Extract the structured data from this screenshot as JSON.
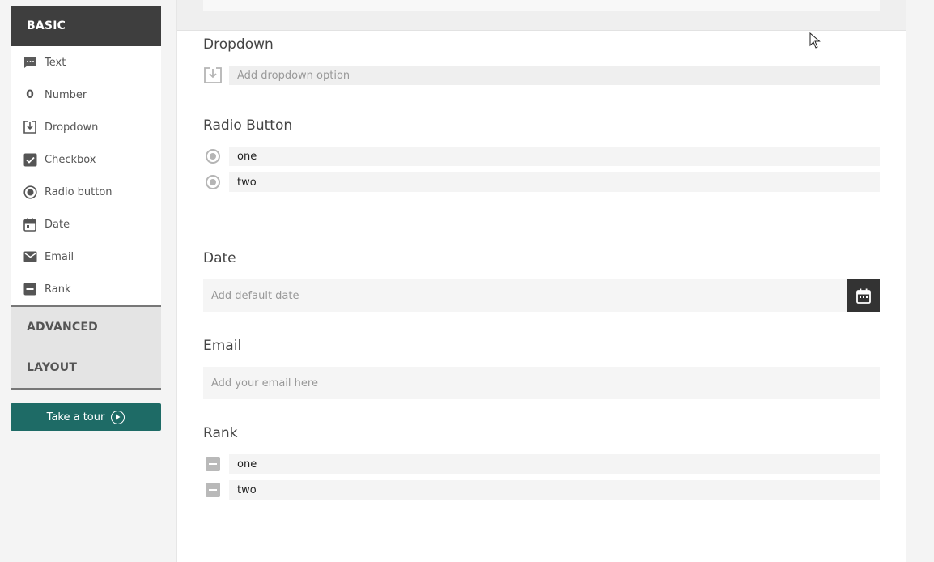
{
  "sidebar": {
    "basic_label": "BASIC",
    "items": [
      {
        "label": "Text",
        "icon": "text-icon"
      },
      {
        "label": "Number",
        "icon": "number-icon"
      },
      {
        "label": "Dropdown",
        "icon": "dropdown-icon"
      },
      {
        "label": "Checkbox",
        "icon": "checkbox-icon"
      },
      {
        "label": "Radio button",
        "icon": "radio-icon"
      },
      {
        "label": "Date",
        "icon": "calendar-icon"
      },
      {
        "label": "Email",
        "icon": "email-icon"
      },
      {
        "label": "Rank",
        "icon": "rank-icon"
      }
    ],
    "number_glyph": "0",
    "advanced_label": "ADVANCED",
    "layout_label": "LAYOUT",
    "tour_label": "Take a tour"
  },
  "form": {
    "dropdown": {
      "title": "Dropdown",
      "placeholder": "Add dropdown option"
    },
    "radio": {
      "title": "Radio Button",
      "options": [
        "one",
        "two"
      ]
    },
    "date": {
      "title": "Date",
      "placeholder": "Add default date"
    },
    "email": {
      "title": "Email",
      "placeholder": "Add your email here"
    },
    "rank": {
      "title": "Rank",
      "options": [
        "one",
        "two"
      ]
    }
  },
  "colors": {
    "active_section": "#3e3e3e",
    "tour_button": "#1e6b66",
    "date_button": "#333333"
  }
}
